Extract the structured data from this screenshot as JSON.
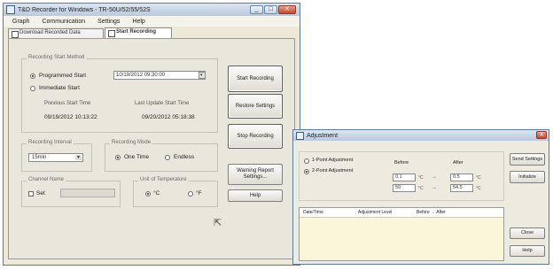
{
  "main_window": {
    "title": "T&D Recorder for Windows - TR-50U/52/55/52S",
    "minimize_glyph": "_",
    "maximize_glyph": "□",
    "close_glyph": "X"
  },
  "menu": [
    "Graph",
    "Communication",
    "Settings",
    "Help"
  ],
  "tabs": [
    {
      "label": "Download Recorded Data",
      "active": false
    },
    {
      "label": "Start Recording",
      "active": true
    }
  ],
  "recording_start": {
    "group_label": "Recording Start Method",
    "programmed_label": "Programmed Start",
    "programmed_value": "10/19/2012 09:30:00",
    "immediate_label": "Immediate Start",
    "prev_start_label": "Previous Start Time",
    "prev_start_value": "09/19/2012 10:13:22",
    "last_update_label": "Last Update Start Time",
    "last_update_value": "09/20/2012 05:18:38"
  },
  "interval": {
    "group_label": "Recording Interval",
    "value": "15min"
  },
  "recording_mode": {
    "group_label": "Recording Mode",
    "one_time": "One Time",
    "endless": "Endless"
  },
  "channel_name": {
    "group_label": "Channel Name",
    "set_label": "Set",
    "value": ""
  },
  "unit": {
    "group_label": "Unit of Temperature",
    "c": "°C",
    "f": "°F"
  },
  "buttons": {
    "start_recording": "Start Recording",
    "restore_settings": "Restore Settings",
    "stop_recording": "Stop Recording",
    "warning_report": "Warning Report Settings...",
    "help": "Help"
  },
  "adjustment": {
    "title": "Adjustment",
    "mode_1": "1-Point Adjustment",
    "mode_2": "2-Point Adjustment",
    "before_label": "Before",
    "after_label": "After",
    "row1_before": "0.1",
    "row1_after": "0.5",
    "row2_before": "50",
    "row2_after": "54.5",
    "unit": "°C",
    "arrow": "→",
    "col_date": "Date/Time",
    "col_adj": "Adjustment Level",
    "col_before_after": "Before  →  After",
    "btn_send": "Send Settings",
    "btn_initialize": "Initialize",
    "btn_close": "Close",
    "btn_help": "Help"
  }
}
